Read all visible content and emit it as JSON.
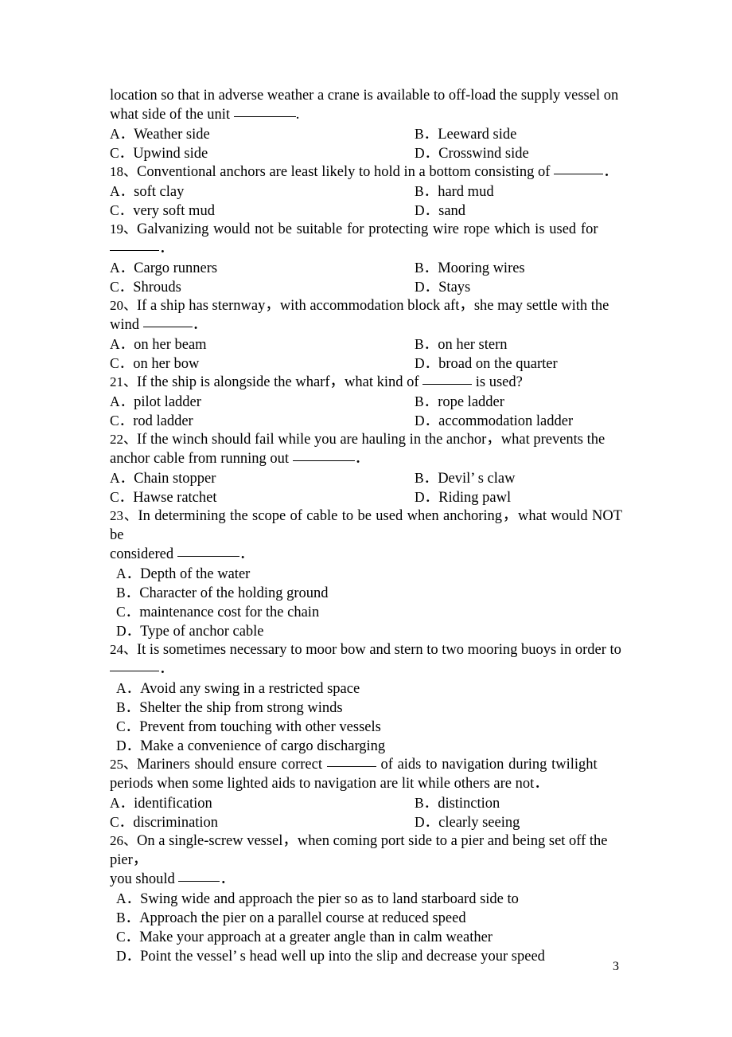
{
  "page": {
    "number": "3",
    "continued_text_line1": "location so that in adverse weather a crane is available to off-load the supply vessel on",
    "continued_text_line2_prefix": "what side of the unit ",
    "continued_text_line2_suffix": "."
  },
  "questions": [
    {
      "number": "",
      "stem": "",
      "options": [
        {
          "label": "A．",
          "text": "Weather side"
        },
        {
          "label": "B．",
          "text": "Leeward side"
        },
        {
          "label": "C．",
          "text": "Upwind side"
        },
        {
          "label": "D．",
          "text": "Crosswind side"
        }
      ],
      "layout": "two-column"
    },
    {
      "number": "18、",
      "stem_before_blank": "Conventional anchors are least likely to hold in a bottom consisting of ",
      "stem_after_blank": "．",
      "options": [
        {
          "label": "A．",
          "text": "soft clay"
        },
        {
          "label": "B．",
          "text": "hard mud"
        },
        {
          "label": "C．",
          "text": "very soft mud"
        },
        {
          "label": "D．",
          "text": "sand"
        }
      ],
      "layout": "two-column"
    },
    {
      "number": "19、",
      "stem_line1": "Galvanizing would not be suitable for protecting wire rope which is used for",
      "stem_line2_after_blank": "．",
      "options": [
        {
          "label": "A．",
          "text": "Cargo runners"
        },
        {
          "label": "B．",
          "text": "Mooring wires"
        },
        {
          "label": "C．",
          "text": "Shrouds"
        },
        {
          "label": "D．",
          "text": "Stays"
        }
      ],
      "layout": "two-column"
    },
    {
      "number": "20、",
      "stem_line1": "If a ship has sternway，with accommodation block aft，she may settle with the",
      "stem_line2_before_blank": "wind ",
      "stem_line2_after_blank": "．",
      "options": [
        {
          "label": "A．",
          "text": "on her beam"
        },
        {
          "label": "B．",
          "text": "on her stern"
        },
        {
          "label": "C．",
          "text": "on her bow"
        },
        {
          "label": "D．",
          "text": "broad on the quarter"
        }
      ],
      "layout": "two-column"
    },
    {
      "number": "21、",
      "stem_before_blank": "If the ship is alongside the wharf，what kind of ",
      "stem_after_blank": " is used?",
      "options": [
        {
          "label": "A．",
          "text": "pilot ladder"
        },
        {
          "label": "B．",
          "text": "rope ladder"
        },
        {
          "label": "C．",
          "text": "rod ladder"
        },
        {
          "label": "D．",
          "text": "accommodation ladder"
        }
      ],
      "layout": "two-column"
    },
    {
      "number": "22、",
      "stem_line1": "If the winch should fail while you are hauling in the anchor，what prevents the",
      "stem_line2_before_blank": "anchor cable from running out ",
      "stem_line2_after_blank": "．",
      "options": [
        {
          "label": "A．",
          "text": "Chain stopper"
        },
        {
          "label": "B．",
          "text": "Devil’ s claw"
        },
        {
          "label": "C．",
          "text": "Hawse ratchet"
        },
        {
          "label": "D．",
          "text": "Riding pawl"
        }
      ],
      "layout": "two-column"
    },
    {
      "number": "23、",
      "stem_line1": "In determining the scope of cable to be used when anchoring，what would NOT be",
      "stem_line2_before_blank": "considered ",
      "stem_line2_after_blank": "．",
      "options": [
        {
          "label": "A．",
          "text": "Depth of the water"
        },
        {
          "label": "B．",
          "text": "Character of the holding ground"
        },
        {
          "label": "C．",
          "text": "maintenance cost for the chain"
        },
        {
          "label": "D．",
          "text": "Type of anchor cable"
        }
      ],
      "layout": "stacked"
    },
    {
      "number": "24、",
      "stem_line1": "It is sometimes necessary to moor bow and stern to two mooring buoys in order to",
      "stem_line2_after_blank": "．",
      "options": [
        {
          "label": "A．",
          "text": "Avoid any swing in a restricted space"
        },
        {
          "label": "B．",
          "text": "Shelter the ship from strong winds"
        },
        {
          "label": "C．",
          "text": "Prevent from touching with other vessels"
        },
        {
          "label": "D．",
          "text": "Make a convenience of cargo discharging"
        }
      ],
      "layout": "stacked"
    },
    {
      "number": "25、",
      "stem_line1_before_blank": "Mariners should ensure correct ",
      "stem_line1_after_blank": " of aids to navigation during twilight",
      "stem_line2": "periods when some lighted aids to navigation are lit while others are not．",
      "options": [
        {
          "label": "A．",
          "text": "identification"
        },
        {
          "label": "B．",
          "text": "distinction"
        },
        {
          "label": "C．",
          "text": "discrimination"
        },
        {
          "label": "D．",
          "text": "clearly seeing"
        }
      ],
      "layout": "two-column"
    },
    {
      "number": "26、",
      "stem_line1": "On a single-screw vessel，when coming port side to a pier and being set off the pier，",
      "stem_line2_before_blank": "you should ",
      "stem_line2_after_blank": "．",
      "options": [
        {
          "label": "A．",
          "text": "Swing wide and approach the pier so as to land starboard side to"
        },
        {
          "label": "B．",
          "text": "Approach the pier on a parallel course at reduced speed"
        },
        {
          "label": "C．",
          "text": "Make your approach at a greater angle than in calm weather"
        },
        {
          "label": "D．",
          "text": "Point the vessel’ s head well up into the slip and decrease your speed"
        }
      ],
      "layout": "stacked"
    }
  ]
}
